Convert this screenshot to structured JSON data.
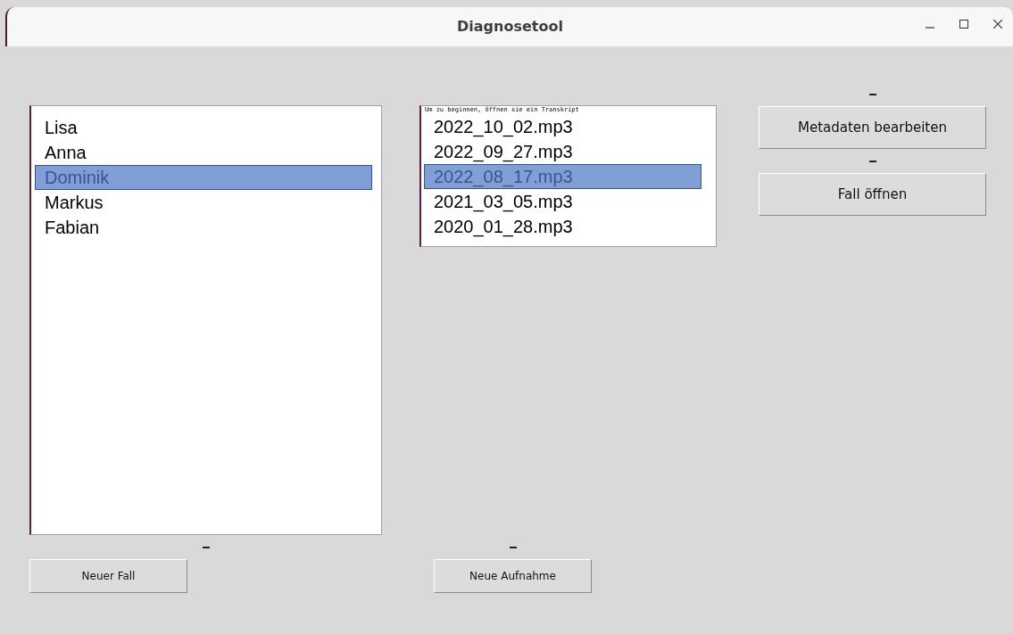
{
  "window": {
    "title": "Diagnosetool"
  },
  "cases": [
    {
      "label": "Lisa",
      "selected": false
    },
    {
      "label": "Anna",
      "selected": false
    },
    {
      "label": "Dominik",
      "selected": true
    },
    {
      "label": "Markus",
      "selected": false
    },
    {
      "label": "Fabian",
      "selected": false
    }
  ],
  "recordings": {
    "hint": "Um zu beginnen, öffnen sie ein Transkript",
    "items": [
      {
        "label": "2022_10_02.mp3",
        "selected": false
      },
      {
        "label": "2022_09_27.mp3",
        "selected": false
      },
      {
        "label": "2022_08_17.mp3",
        "selected": true
      },
      {
        "label": "2021_03_05.mp3",
        "selected": false
      },
      {
        "label": "2020_01_28.mp3",
        "selected": false
      }
    ]
  },
  "buttons": {
    "edit_metadata": "Metadaten bearbeiten",
    "open_case": "Fall öffnen",
    "new_case": "Neuer Fall",
    "new_recording": "Neue Aufnahme"
  }
}
